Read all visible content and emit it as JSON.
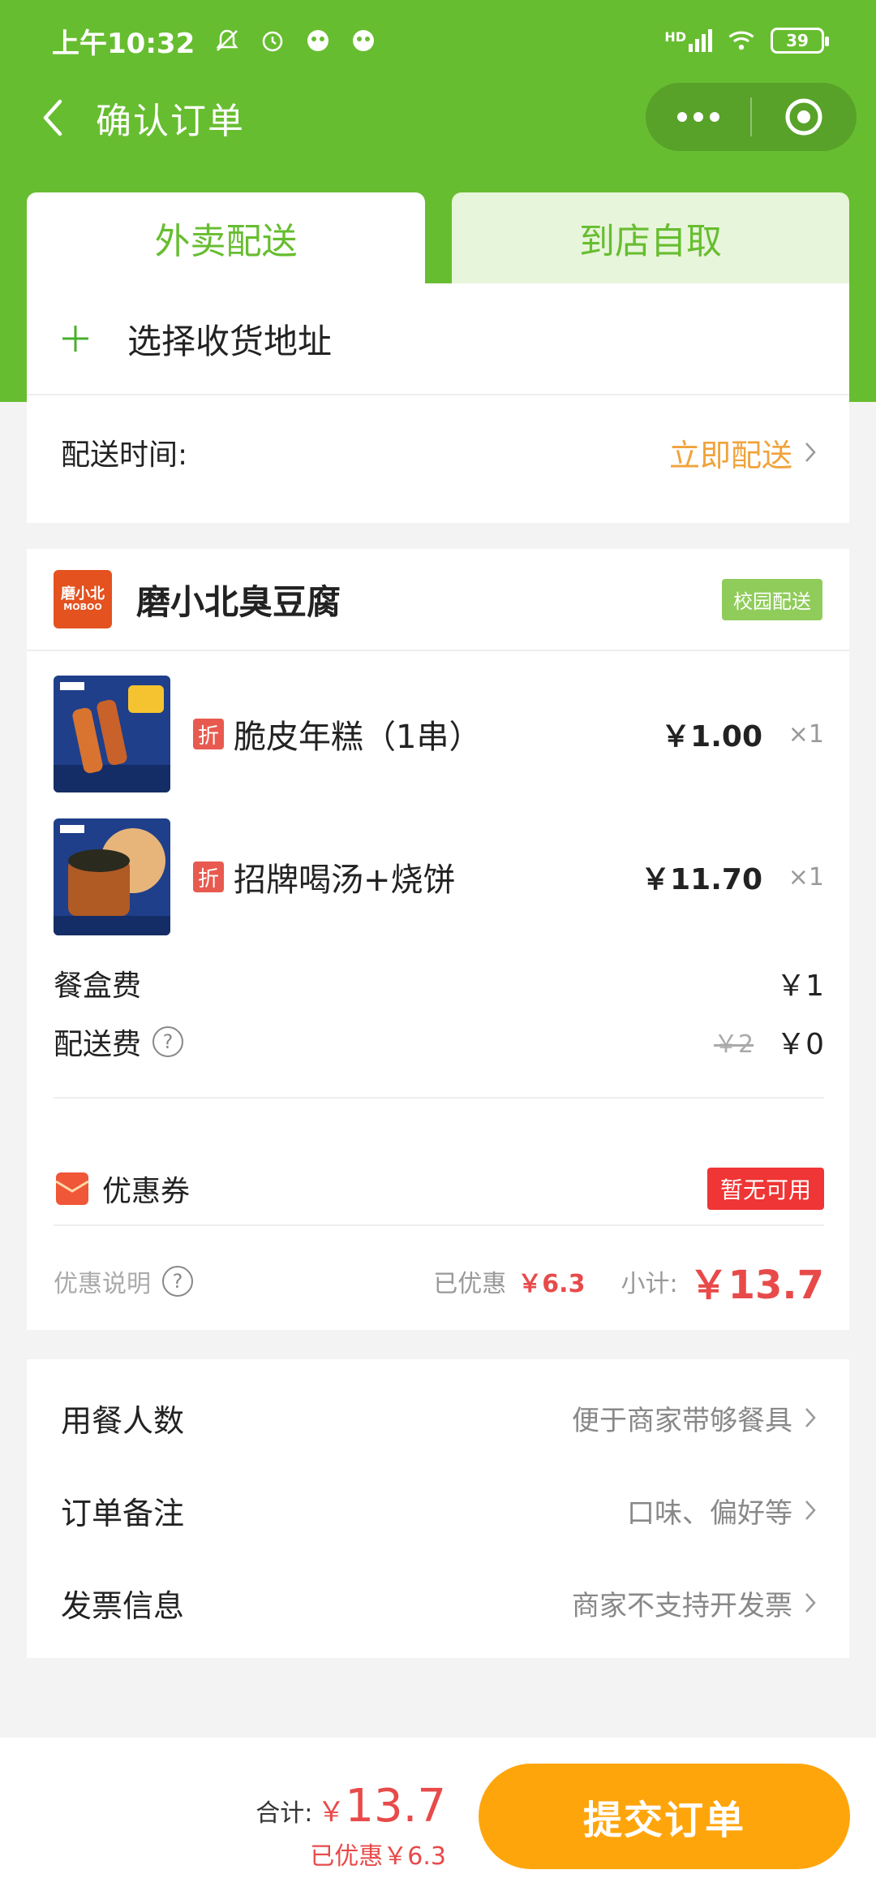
{
  "status_bar": {
    "time": "上午10:32",
    "battery": "39",
    "network": "HD"
  },
  "nav": {
    "title": "确认订单"
  },
  "tabs": {
    "delivery": "外卖配送",
    "pickup": "到店自取"
  },
  "address": {
    "select_label": "选择收货地址"
  },
  "delivery_time": {
    "label": "配送时间:",
    "value": "立即配送"
  },
  "store": {
    "logo_text": "磨小北",
    "logo_sub": "MOBOO",
    "name": "磨小北臭豆腐",
    "badge": "校园配送"
  },
  "items": [
    {
      "tag": "折",
      "name": "脆皮年糕（1串）",
      "price": "￥1.00",
      "qty": "×1"
    },
    {
      "tag": "折",
      "name": "招牌喝汤+烧饼",
      "price": "￥11.70",
      "qty": "×1"
    }
  ],
  "fees": {
    "box_label": "餐盒费",
    "box_value": "￥1",
    "delivery_label": "配送费",
    "delivery_old": "￥2",
    "delivery_value": "￥0",
    "help_glyph": "?"
  },
  "coupon": {
    "label": "优惠券",
    "status": "暂无可用"
  },
  "summary": {
    "note_label": "优惠说明",
    "saved_label": "已优惠",
    "saved_value": "￥6.3",
    "subtotal_label": "小计:",
    "subtotal_value": "￥13.7"
  },
  "options": [
    {
      "label": "用餐人数",
      "value": "便于商家带够餐具"
    },
    {
      "label": "订单备注",
      "value": "口味、偏好等"
    },
    {
      "label": "发票信息",
      "value": "商家不支持开发票"
    }
  ],
  "footer": {
    "total_label": "合计:",
    "total_symbol": "￥",
    "total_value": "13.7",
    "saved_text": "已优惠￥6.3",
    "submit_label": "提交订单"
  },
  "colors": {
    "brand_green": "#67bd30",
    "accent_orange": "#ffa50c",
    "price_red": "#e84a4a"
  }
}
